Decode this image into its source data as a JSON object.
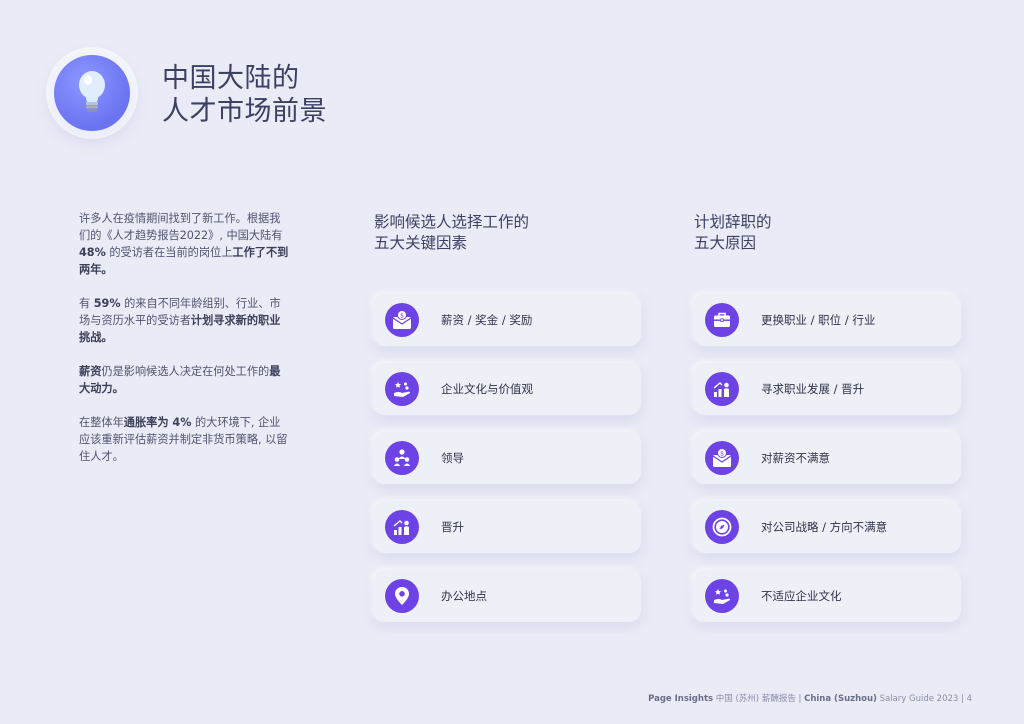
{
  "header": {
    "title_line1": "中国大陆的",
    "title_line2": "人才市场前景",
    "icon": "lightbulb-icon"
  },
  "intro": {
    "p1_a": "许多人在疫情期间找到了新工作。根据我们的《人才趋势报告2022》, 中国大陆有 ",
    "p1_b": "48%",
    "p1_c": " 的受访者在当前的岗位上",
    "p1_d": "工作了不到两年。",
    "p2_a": "有 ",
    "p2_b": "59%",
    "p2_c": " 的来自不同年龄组别、行业、市场与资历水平的受访者",
    "p2_d": "计划寻求新的职业挑战。",
    "p3_a": "薪资",
    "p3_b": "仍是影响候选人决定在何处工作的",
    "p3_c": "最大动力。",
    "p4_a": "在整体年",
    "p4_b": "通胀率为 4%",
    "p4_c": " 的大环境下, 企业应该重新评估薪资并制定非货币策略, 以留住人才。"
  },
  "factors": {
    "heading_line1": "影响候选人选择工作的",
    "heading_line2": "五大关键因素",
    "items": [
      {
        "label": "薪资 / 奖金 / 奖励",
        "icon": "salary-envelope-icon"
      },
      {
        "label": "企业文化与价值观",
        "icon": "hand-culture-icon"
      },
      {
        "label": "领导",
        "icon": "leadership-people-icon"
      },
      {
        "label": "晋升",
        "icon": "growth-chart-icon"
      },
      {
        "label": "办公地点",
        "icon": "location-pin-icon"
      }
    ]
  },
  "reasons": {
    "heading_line1": "计划辞职的",
    "heading_line2": "五大原因",
    "items": [
      {
        "label": "更换职业 / 职位 / 行业",
        "icon": "briefcase-icon"
      },
      {
        "label": "寻求职业发展 / 晋升",
        "icon": "growth-chart-icon"
      },
      {
        "label": "对薪资不满意",
        "icon": "salary-envelope-icon"
      },
      {
        "label": "对公司战略 / 方向不满意",
        "icon": "compass-icon"
      },
      {
        "label": "不适应企业文化",
        "icon": "hand-culture-icon"
      }
    ]
  },
  "footer": {
    "brand": "Page Insights",
    "cn_title": " 中国 (苏州) 薪酬报告 ",
    "sep": " | ",
    "en_title_bold": "China (Suzhou)",
    "en_title_rest": " Salary Guide 2023",
    "page": "4"
  },
  "colors": {
    "accent": "#6e43e6",
    "background": "#e9ebf6",
    "bulb": "#7a83f5"
  }
}
